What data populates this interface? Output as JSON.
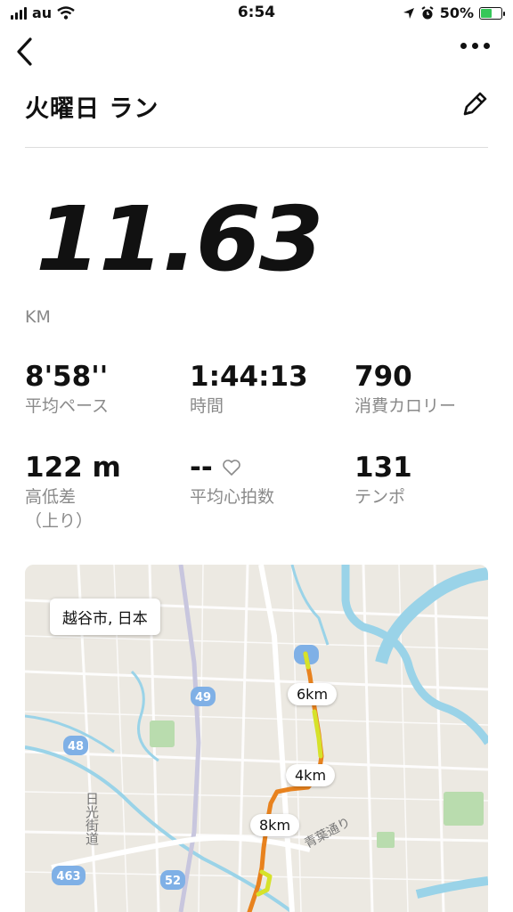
{
  "status_bar": {
    "carrier": "au",
    "time": "6:54",
    "battery": "50%",
    "battery_level": 0.5
  },
  "header": {
    "title": "火曜日 ラン"
  },
  "summary": {
    "distance": "11.63",
    "distance_unit": "KM"
  },
  "stats": [
    {
      "value": "8'58''",
      "label": "平均ペース"
    },
    {
      "value": "1:44:13",
      "label": "時間"
    },
    {
      "value": "790",
      "label": "消費カロリー"
    },
    {
      "value": "122 m",
      "label": "高低差",
      "label2": "（上り）"
    },
    {
      "value": "--",
      "label": "平均心拍数"
    },
    {
      "value": "131",
      "label": "テンポ"
    }
  ],
  "map": {
    "location": "越谷市, 日本",
    "markers": [
      "6km",
      "4km",
      "8km"
    ],
    "road_labels": [
      "49",
      "48",
      "463",
      "52",
      "日光街道",
      "青葉通り"
    ]
  },
  "colors": {
    "route_orange": "#e8821e",
    "route_yellow": "#d6e22a",
    "water": "#9ad3e8",
    "battery_green": "#35c759"
  }
}
